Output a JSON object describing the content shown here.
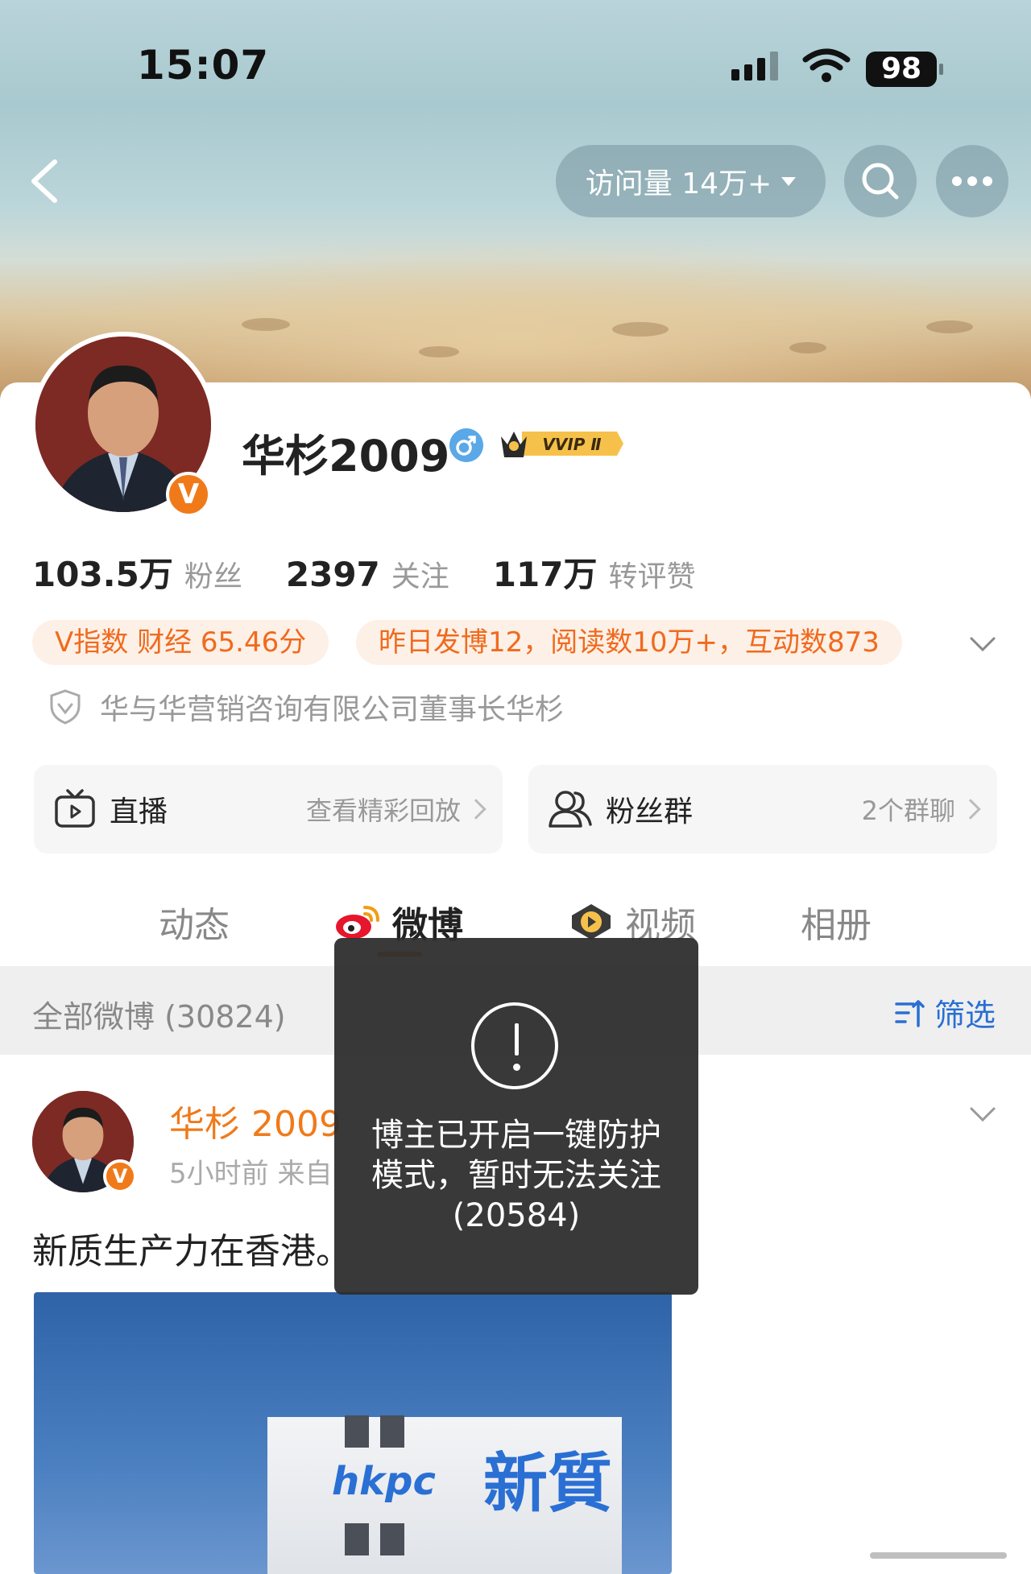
{
  "status_bar": {
    "time": "15:07",
    "battery": "98"
  },
  "header": {
    "visits_label": "访问量 14万+"
  },
  "profile": {
    "name": "华杉2009",
    "vip_badge": "VVIP Ⅱ",
    "verified_mark": "V",
    "stats": [
      {
        "value": "103.5万",
        "label": "粉丝"
      },
      {
        "value": "2397",
        "label": "关注"
      },
      {
        "value": "117万",
        "label": "转评赞"
      }
    ],
    "tags": [
      "V指数 财经 65.46分",
      "昨日发博12，阅读数10万+，互动数873"
    ],
    "certification": "华与华营销咨询有限公司董事长华杉"
  },
  "features": {
    "live": {
      "title": "直播",
      "subtitle": "查看精彩回放"
    },
    "fans_group": {
      "title": "粉丝群",
      "subtitle": "2个群聊"
    }
  },
  "tabs": [
    {
      "label": "动态"
    },
    {
      "label": "微博"
    },
    {
      "label": "视频"
    },
    {
      "label": "相册"
    }
  ],
  "filter_bar": {
    "all_label": "全部微博 (30824)",
    "filter_label": "筛选"
  },
  "post": {
    "author": "华杉 2009",
    "meta": "5小时前  来自",
    "text": "新质生产力在香港。",
    "image_sign_logo": "hkpc",
    "image_sign_cn": "新質"
  },
  "toast": {
    "line1": "博主已开启一键防护",
    "line2": "模式，暂时无法关注",
    "line3": "(20584)"
  },
  "colors": {
    "accent": "#f07a1a",
    "link_blue": "#2a6fd3",
    "toast_bg": "#2d2d2d"
  }
}
